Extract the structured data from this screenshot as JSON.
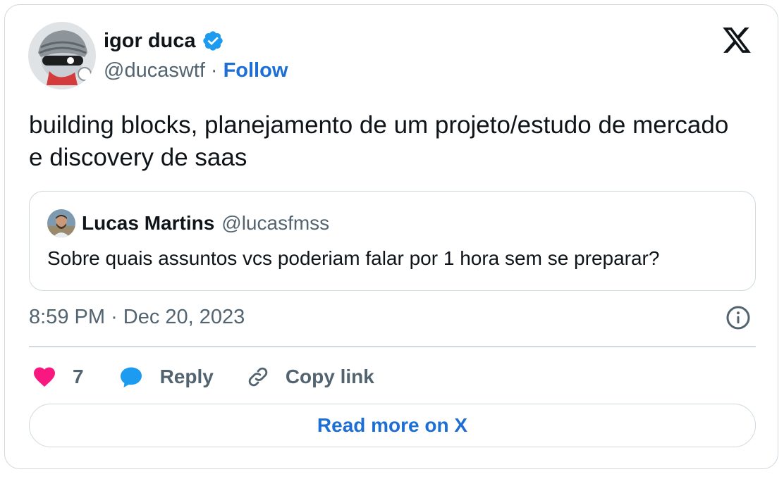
{
  "author": {
    "name": "igor duca",
    "handle": "@ducaswtf",
    "separator": "·",
    "follow_label": "Follow",
    "avatar_icon": "cartoon-avatar-icon",
    "verified_icon": "verified-badge-icon"
  },
  "brand": {
    "logo_icon": "x-logo-icon"
  },
  "tweet": {
    "text": "building blocks, planejamento de um projeto/estudo de mercado e discovery de saas",
    "time": "8:59 PM",
    "meta_separator": "·",
    "date": "Dec 20, 2023"
  },
  "quoted_tweet": {
    "name": "Lucas Martins",
    "handle": "@lucasfmss",
    "text": "Sobre quais assuntos vcs poderiam falar por 1 hora sem se preparar?"
  },
  "actions": {
    "like_count": "7",
    "reply_label": "Reply",
    "copy_link_label": "Copy link"
  },
  "footer": {
    "read_more_label": "Read more on X"
  },
  "colors": {
    "accent": "#1d6fd6",
    "verified": "#1d9bf0",
    "like": "#f91880",
    "muted_text": "#536471",
    "border": "#cfd9de"
  }
}
